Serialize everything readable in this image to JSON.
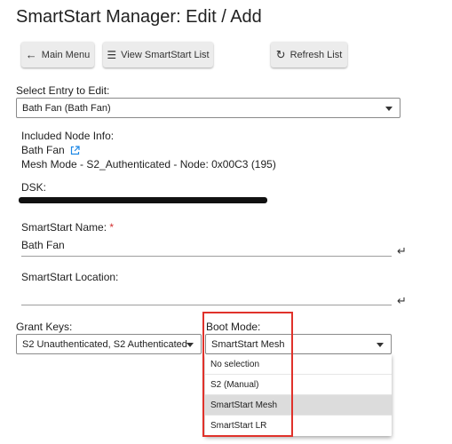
{
  "page_title": "SmartStart Manager: Edit / Add",
  "buttons": {
    "main_menu": "Main Menu",
    "view_list": "View SmartStart List",
    "refresh": "Refresh List"
  },
  "select_entry": {
    "label": "Select Entry to Edit:",
    "value": "Bath Fan (Bath Fan)"
  },
  "included_node": {
    "label": "Included Node Info:",
    "name": "Bath Fan",
    "details": "Mesh Mode - S2_Authenticated - Node: 0x00C3 (195)"
  },
  "dsk": {
    "label": "DSK:"
  },
  "name_field": {
    "label": "SmartStart Name:",
    "required_mark": "*",
    "value": "Bath Fan"
  },
  "location_field": {
    "label": "SmartStart Location:",
    "value": ""
  },
  "grant_keys": {
    "label": "Grant Keys:",
    "value": "S2 Unauthenticated, S2 Authenticated"
  },
  "boot_mode": {
    "label": "Boot Mode:",
    "value": "SmartStart Mesh",
    "options": [
      "No selection",
      "S2 (Manual)",
      "SmartStart Mesh",
      "SmartStart LR"
    ]
  },
  "colors": {
    "highlight": "#e0322b",
    "link_icon": "#1e88e5",
    "required": "#d32f2f"
  }
}
